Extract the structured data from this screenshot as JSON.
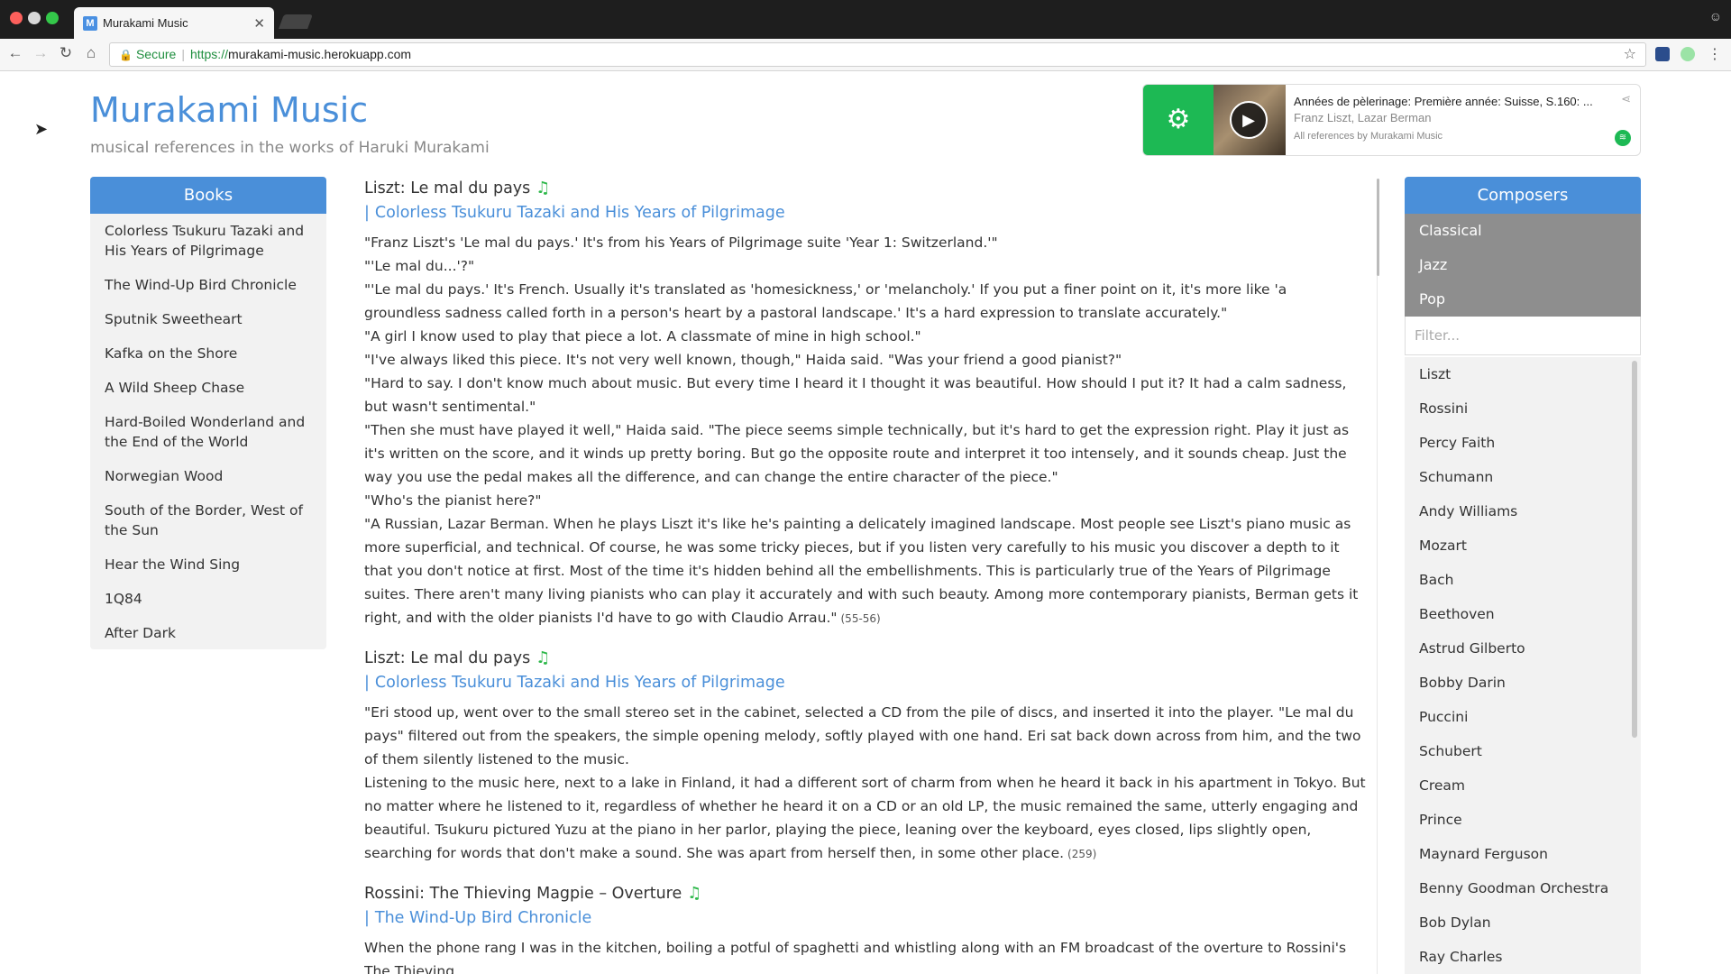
{
  "browser": {
    "tab_title": "Murakami Music",
    "tab_favicon": "M",
    "secure_label": "Secure",
    "url_scheme": "https://",
    "url_host": "murakami-music.herokuapp.com"
  },
  "site": {
    "title": "Murakami Music",
    "subtitle": "musical references in the works of Haruki Murakami"
  },
  "player": {
    "track": "Années de pèlerinage: Première année: Suisse, S.160: ...",
    "artists": "Franz Liszt, Lazar Berman",
    "attribution": "All references by Murakami Music"
  },
  "books": {
    "heading": "Books",
    "items": [
      "Colorless Tsukuru Tazaki and His Years of Pilgrimage",
      "The Wind-Up Bird Chronicle",
      "Sputnik Sweetheart",
      "Kafka on the Shore",
      "A Wild Sheep Chase",
      "Hard-Boiled Wonderland and the End of the World",
      "Norwegian Wood",
      "South of the Border, West of the Sun",
      "Hear the Wind Sing",
      "1Q84",
      "After Dark"
    ]
  },
  "entries": [
    {
      "title": "Liszt: Le mal du pays",
      "book": "Colorless Tsukuru Tazaki and His Years of Pilgrimage",
      "paragraphs": [
        "\"Franz Liszt's 'Le mal du pays.' It's from his Years of Pilgrimage suite 'Year 1: Switzerland.'\"",
        "\"'Le mal du...'?\"",
        "\"'Le mal du pays.' It's French. Usually it's translated as 'homesickness,' or 'melancholy.' If you put a finer point on it, it's more like 'a groundless sadness called forth in a person's heart by a pastoral landscape.' It's a hard expression to translate accurately.\"",
        "\"A girl I know used to play that piece a lot. A classmate of mine in high school.\"",
        "\"I've always liked this piece. It's not very well known, though,\" Haida said. \"Was your friend a good pianist?\"",
        "\"Hard to say. I don't know much about music. But every time I heard it I thought it was beautiful. How should I put it? It had a calm sadness, but wasn't sentimental.\"",
        "\"Then she must have played it well,\" Haida said. \"The piece seems simple technically, but it's hard to get the expression right. Play it just as it's written on the score, and it winds up pretty boring. But go the opposite route and interpret it too intensely, and it sounds cheap. Just the way you use the pedal makes all the difference, and can change the entire character of the piece.\"",
        "\"Who's the pianist here?\"",
        "\"A Russian, Lazar Berman. When he plays Liszt it's like he's painting a delicately imagined landscape. Most people see Liszt's piano music as more superficial, and technical. Of course, he was some tricky pieces, but if you listen very carefully to his music you discover a depth to it that you don't notice at first. Most of the time it's hidden behind all the embellishments. This is particularly true of the Years of Pilgrimage suites. There aren't many living pianists who can play it accurately and with such beauty. Among more contemporary pianists, Berman gets it right, and with the older pianists I'd have to go with Claudio Arrau.\""
      ],
      "pages": "(55-56)"
    },
    {
      "title": "Liszt: Le mal du pays",
      "book": "Colorless Tsukuru Tazaki and His Years of Pilgrimage",
      "paragraphs": [
        "\"Eri stood up, went over to the small stereo set in the cabinet, selected a CD from the pile of discs, and inserted it into the player. \"Le mal du pays\" filtered out from the speakers, the simple opening melody, softly played with one hand. Eri sat back down across from him, and the two of them silently listened to the music.",
        "Listening to the music here, next to a lake in Finland, it had a different sort of charm from when he heard it back in his apartment in Tokyo. But no matter where he listened to it, regardless of whether he heard it on a CD or an old LP, the music remained the same, utterly engaging and beautiful. Tsukuru pictured Yuzu at the piano in her parlor, playing the piece, leaning over the keyboard, eyes closed, lips slightly open, searching for words that don't make a sound. She was apart from herself then, in some other place."
      ],
      "pages": "(259)"
    },
    {
      "title": "Rossini: The Thieving Magpie – Overture",
      "book": "The Wind-Up Bird Chronicle",
      "paragraphs": [
        "When the phone rang I was in the kitchen, boiling a potful of spaghetti and whistling along with an FM broadcast of the overture to Rossini's The Thieving"
      ],
      "pages": ""
    }
  ],
  "composers": {
    "heading": "Composers",
    "genres": [
      "Classical",
      "Jazz",
      "Pop"
    ],
    "filter_placeholder": "Filter...",
    "items": [
      "Liszt",
      "Rossini",
      "Percy Faith",
      "Schumann",
      "Andy Williams",
      "Mozart",
      "Bach",
      "Beethoven",
      "Astrud Gilberto",
      "Bobby Darin",
      "Puccini",
      "Schubert",
      "Cream",
      "Prince",
      "Maynard Ferguson",
      "Benny Goodman Orchestra",
      "Bob Dylan",
      "Ray Charles"
    ]
  },
  "icons": {
    "note": "music-note-icon",
    "gear": "gear-icon",
    "play": "play-icon",
    "share": "share-icon",
    "spotify": "spotify-icon"
  },
  "colors": {
    "accent_blue": "#4a8fd9",
    "spotify_green": "#1db954",
    "genre_gray": "#8e8e8e",
    "panel_bg": "#f2f2f2"
  }
}
